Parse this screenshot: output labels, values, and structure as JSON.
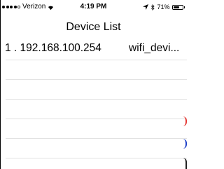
{
  "status_bar": {
    "carrier": "Verizon",
    "time": "4:19 PM",
    "battery": "71%",
    "battery_level": 0.71,
    "signal_bars_filled": 4,
    "signal_bars_total": 5,
    "icons": [
      "signal-icon",
      "wifi-icon",
      "location-icon",
      "bluetooth-icon",
      "battery-icon"
    ]
  },
  "nav": {
    "title": "Device List"
  },
  "devices": [
    {
      "index_ip": "1 . 192.168.100.254",
      "name": "wifi_devi..."
    }
  ],
  "colors": {
    "background": "#ffffff",
    "separator": "#e2e2e2",
    "accent_red": "#e53935",
    "accent_blue": "#1e40c8"
  }
}
